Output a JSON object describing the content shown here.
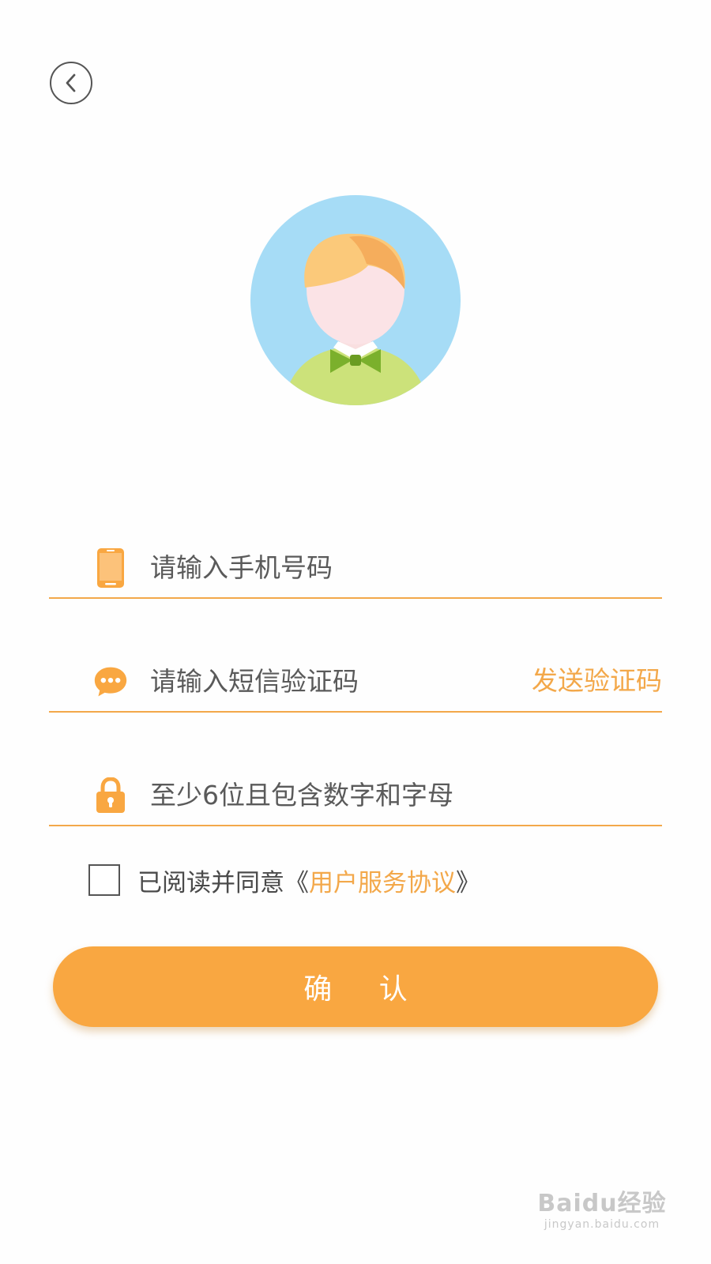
{
  "header": {
    "back_icon": "chevron-left-icon"
  },
  "avatar": {
    "icon": "user-avatar-illustration",
    "background_color": "#a6dcf6"
  },
  "form": {
    "phone": {
      "icon": "phone-icon",
      "placeholder": "请输入手机号码",
      "value": ""
    },
    "sms_code": {
      "icon": "chat-bubble-icon",
      "placeholder": "请输入短信验证码",
      "value": "",
      "send_button_label": "发送验证码"
    },
    "password": {
      "icon": "lock-icon",
      "placeholder": "至少6位且包含数字和字母",
      "value": ""
    },
    "agreement": {
      "checked": false,
      "prefix_text": "已阅读并同意《",
      "link_text": "用户服务协议",
      "suffix_text": "》"
    },
    "confirm_label": "确 认"
  },
  "watermark": {
    "logo_text": "Baidu经验",
    "url_text": "jingyan.baidu.com"
  },
  "colors": {
    "accent": "#f9a741",
    "underline": "#f3a84a",
    "text": "#555555"
  }
}
